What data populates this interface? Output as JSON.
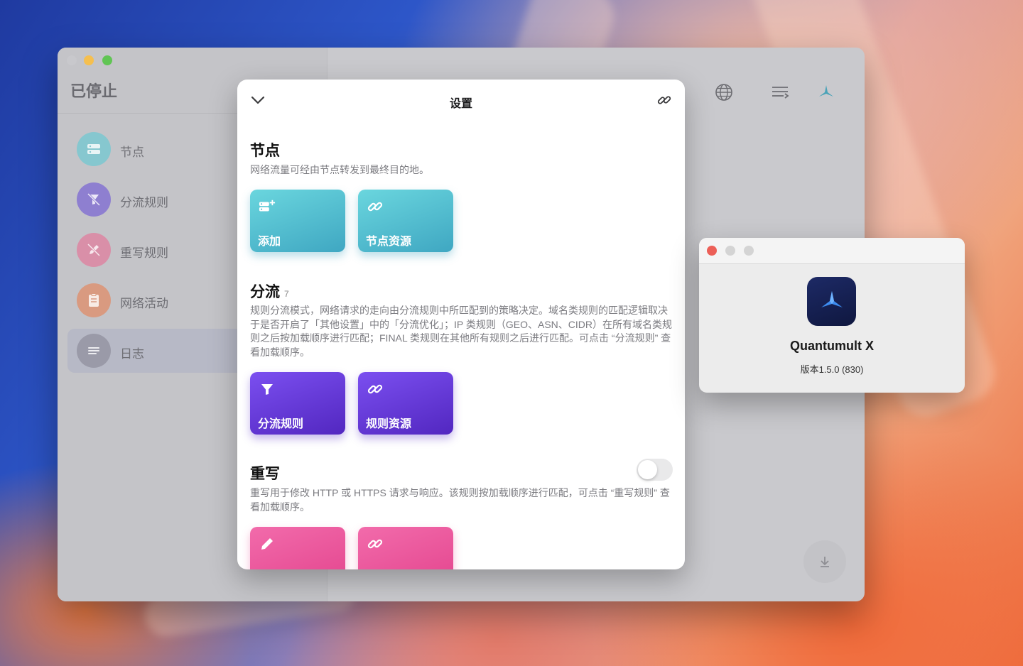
{
  "main_window": {
    "status_title": "已停止",
    "sidebar": {
      "items": [
        {
          "label": "节点",
          "icon": "server-icon",
          "color": "#86c7cf"
        },
        {
          "label": "分流规则",
          "icon": "filter-slash-icon",
          "color": "#8e7fd0"
        },
        {
          "label": "重写规则",
          "icon": "pencil-slash-icon",
          "color": "#d98fa8"
        },
        {
          "label": "网络活动",
          "icon": "clipboard-icon",
          "color": "#d99a80"
        },
        {
          "label": "日志",
          "icon": "lines-icon",
          "color": "#9a9aa8"
        }
      ],
      "active_index": 4
    },
    "toolbar": {
      "icons": [
        "globe-icon",
        "list-arrow-icon",
        "app-logo-icon"
      ]
    }
  },
  "settings": {
    "title": "设置",
    "sections": {
      "nodes": {
        "heading": "节点",
        "description": "网络流量可经由节点转发到最终目的地。",
        "cards": [
          {
            "label": "添加",
            "icon": "add-server-icon"
          },
          {
            "label": "节点资源",
            "icon": "link-icon"
          }
        ]
      },
      "filter": {
        "heading": "分流",
        "count": "7",
        "description": "规则分流模式，网络请求的走向由分流规则中所匹配到的策略决定。域名类规则的匹配逻辑取决于是否开启了「其他设置」中的「分流优化」；IP 类规则（GEO、ASN、CIDR）在所有域名类规则之后按加载顺序进行匹配；FINAL 类规则在其他所有规则之后进行匹配。可点击 “分流规则” 查看加载顺序。",
        "cards": [
          {
            "label": "分流规则",
            "icon": "filter-icon"
          },
          {
            "label": "规则资源",
            "icon": "link-icon"
          }
        ]
      },
      "rewrite": {
        "heading": "重写",
        "enabled": false,
        "description": "重写用于修改 HTTP 或 HTTPS 请求与响应。该规则按加载顺序进行匹配，可点击 “重写规则” 查看加载顺序。",
        "cards": [
          {
            "label": "",
            "icon": "pencil-icon"
          },
          {
            "label": "",
            "icon": "link-icon"
          }
        ]
      }
    }
  },
  "about": {
    "app_name": "Quantumult X",
    "version": "版本1.5.0 (830)"
  },
  "colors": {
    "teal": "#4fb8cc",
    "purple": "#6a3ae0",
    "pink": "#ec5a9c",
    "close_red": "#ec5f57"
  }
}
